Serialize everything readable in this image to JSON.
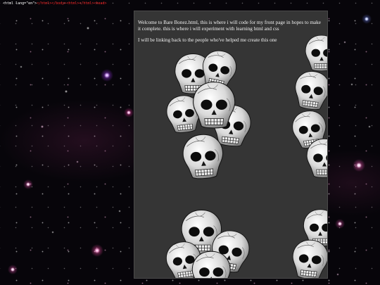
{
  "top_bar": {
    "lang_text": "&lt;html lang=\"en\"&gt;",
    "tag_text": "&lt;&#47;html&gt;&lt;&#47;body&gt;&lt;html&gt;&lt;&#47;html&gt;&lt;head&gt;"
  },
  "intro": {
    "paragraph1": "Welcome to Bare Bonez.html, this is where i will code for my front page in hopes to make it complete. this is where i will experiment with learning html and css",
    "paragraph2": "I will be linking back to the people who've helped me create this one"
  },
  "colors": {
    "page_background": "#07050a",
    "panel_background": "#353535",
    "text": "#f2f2f2",
    "code_accent": "#ff2a2a"
  },
  "background": {
    "image": "starfield",
    "panel_image": "skull-pile"
  }
}
